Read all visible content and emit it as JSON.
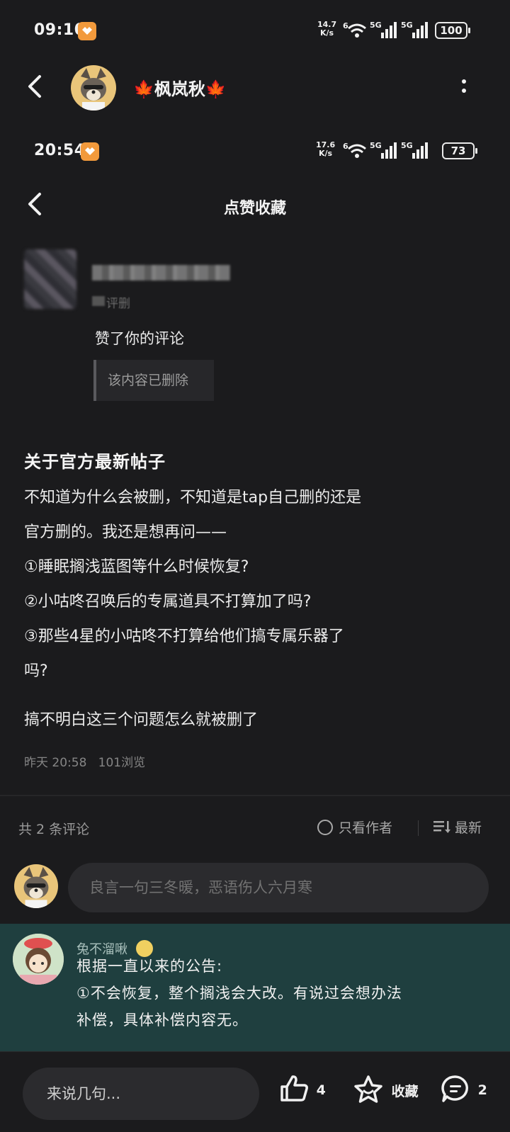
{
  "outer_status": {
    "time": "09:10",
    "speed_top": "14.7",
    "speed_unit": "K/s",
    "net1": "6",
    "net2": "5G",
    "net3": "5G",
    "battery": "100"
  },
  "outer_header": {
    "title": "枫岚秋",
    "title_decor": "🍁"
  },
  "inner_status": {
    "time": "20:54",
    "speed_top": "17.6",
    "speed_unit": "K/s",
    "net1": "6",
    "net2": "5G",
    "net3": "5G",
    "battery": "73"
  },
  "inner_header": {
    "title": "点赞收藏"
  },
  "notification": {
    "name_blurred": "■■■■■■■■",
    "sub_blurred": "评删",
    "action": "赞了你的评论",
    "quoted": "该内容已删除"
  },
  "post": {
    "title": "关于官方最新帖子",
    "lines": [
      "不知道为什么会被删，不知道是tap自己删的还是",
      "官方删的。我还是想再问——",
      "①睡眠搁浅蓝图等什么时候恢复?",
      "②小咕咚召唤后的专属道具不打算加了吗?",
      "③那些4星的小咕咚不打算给他们搞专属乐器了",
      "吗?"
    ],
    "ending": "搞不明白这三个问题怎么就被删了",
    "time": "昨天 20:58",
    "views": "101浏览"
  },
  "comments_bar": {
    "count": "共 2 条评论",
    "only_author": "只看作者",
    "sort": "最新"
  },
  "comment_input": {
    "placeholder": "良言一句三冬暖，恶语伤人六月寒"
  },
  "reply": {
    "name": "兔不溜啾",
    "lines": [
      "根据一直以来的公告:",
      "①不会恢复，整个搁浅会大改。有说过会想办法",
      "补偿，具体补偿内容无。"
    ]
  },
  "bottom_bar": {
    "say_placeholder": "来说几句...",
    "likes": "4",
    "favorite": "收藏",
    "comments": "2"
  },
  "colors": {
    "bg": "#1b1b1d",
    "reply_bg": "#1f3f3f",
    "badge": "#f29a3c",
    "leaf": "#e0402c"
  }
}
